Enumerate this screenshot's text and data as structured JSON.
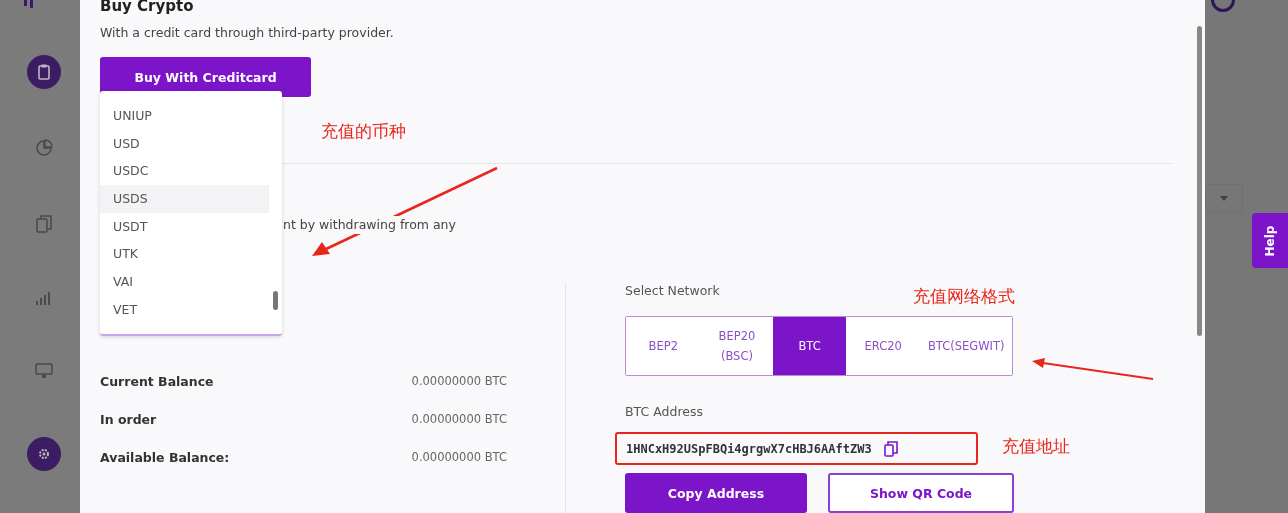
{
  "modal": {
    "title": "Buy Crypto",
    "description": "With a credit card through third-party provider.",
    "buy_button": "Buy With Creditcard",
    "partial_text": "nt by withdrawing from any"
  },
  "dropdown": {
    "items": [
      {
        "label": "UNIUP",
        "selected": false
      },
      {
        "label": "USD",
        "selected": false
      },
      {
        "label": "USDC",
        "selected": false
      },
      {
        "label": "USDS",
        "selected": true
      },
      {
        "label": "USDT",
        "selected": false
      },
      {
        "label": "UTK",
        "selected": false
      },
      {
        "label": "VAI",
        "selected": false
      },
      {
        "label": "VET",
        "selected": false
      }
    ]
  },
  "balances": [
    {
      "label": "Current Balance",
      "value": "0.00000000 BTC"
    },
    {
      "label": "In order",
      "value": "0.00000000 BTC"
    },
    {
      "label": "Available Balance:",
      "value": "0.00000000 BTC"
    }
  ],
  "network": {
    "label": "Select Network",
    "options": [
      {
        "label": "BEP2",
        "selected": false
      },
      {
        "label": "BEP20 (BSC)",
        "selected": false
      },
      {
        "label": "BTC",
        "selected": true
      },
      {
        "label": "ERC20",
        "selected": false
      },
      {
        "label": "BTC(SEGWIT)",
        "selected": false
      }
    ]
  },
  "address": {
    "label": "BTC Address",
    "value": "1HNCxH92USpFBQi4grgwX7cHBJ6AAftZW3",
    "copy_button": "Copy Address",
    "qr_button": "Show QR Code"
  },
  "help_tab": "Help",
  "annotations": [
    "充值的币种",
    "充值网络格式",
    "充值地址"
  ]
}
